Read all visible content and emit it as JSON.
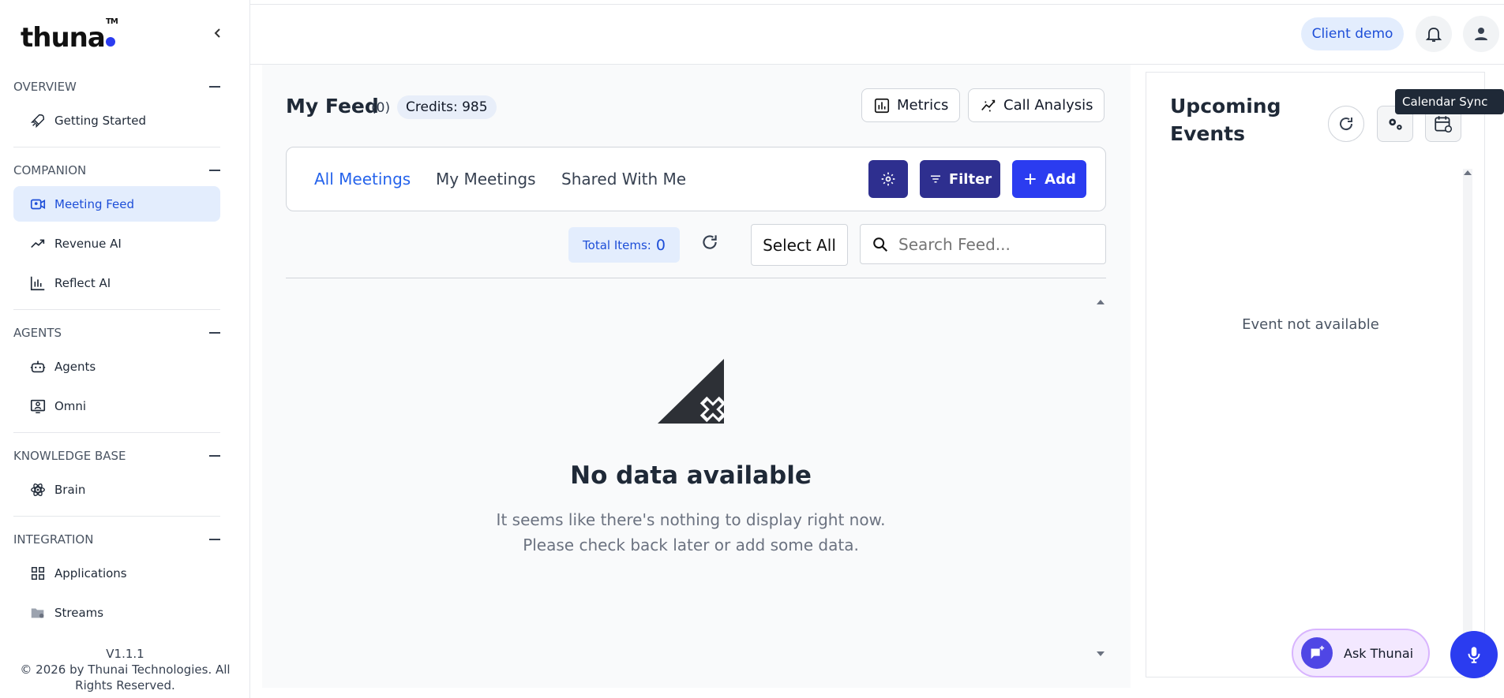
{
  "brand": {
    "logo_text": "thuna",
    "tm": "TM"
  },
  "sidebar": {
    "sections": [
      {
        "title": "OVERVIEW",
        "items": [
          {
            "label": "Getting Started",
            "icon": "rocket-icon"
          }
        ]
      },
      {
        "title": "COMPANION",
        "items": [
          {
            "label": "Meeting Feed",
            "icon": "video-icon",
            "active": true
          },
          {
            "label": "Revenue AI",
            "icon": "trend-icon"
          },
          {
            "label": "Reflect AI",
            "icon": "bar-chart-icon"
          }
        ]
      },
      {
        "title": "AGENTS",
        "items": [
          {
            "label": "Agents",
            "icon": "robot-icon"
          },
          {
            "label": "Omni",
            "icon": "person-screen-icon"
          }
        ]
      },
      {
        "title": "KNOWLEDGE BASE",
        "items": [
          {
            "label": "Brain",
            "icon": "atom-icon"
          }
        ]
      },
      {
        "title": "INTEGRATION",
        "items": [
          {
            "label": "Applications",
            "icon": "grid-icon"
          },
          {
            "label": "Streams",
            "icon": "folder-gear-icon"
          }
        ]
      }
    ],
    "version": "V1.1.1",
    "copyright": "© 2026 by Thunai Technologies. All Rights Reserved."
  },
  "header": {
    "client_label": "Client demo"
  },
  "feed": {
    "title": "My Feed",
    "count": "(0)",
    "credits": "Credits: 985",
    "metrics_label": "Metrics",
    "call_analysis_label": "Call Analysis",
    "tabs": [
      "All Meetings",
      "My Meetings",
      "Shared With Me"
    ],
    "active_tab": "All Meetings",
    "filter_label": "Filter",
    "add_label": "Add",
    "total_items_label": "Total Items:",
    "total_items_value": "0",
    "select_all_label": "Select All",
    "search_placeholder": "Search Feed...",
    "empty_title": "No data available",
    "empty_desc": "It seems like there's nothing to display right now. Please check back later or add some data."
  },
  "events": {
    "title": "Upcoming Events",
    "tooltip": "Calendar Sync",
    "empty": "Event not available"
  },
  "assistant": {
    "ask_label": "Ask Thunai"
  },
  "colors": {
    "accent": "#2b3cf0",
    "dark_accent": "#2e2f8f",
    "active_bg": "#e3edfd"
  }
}
